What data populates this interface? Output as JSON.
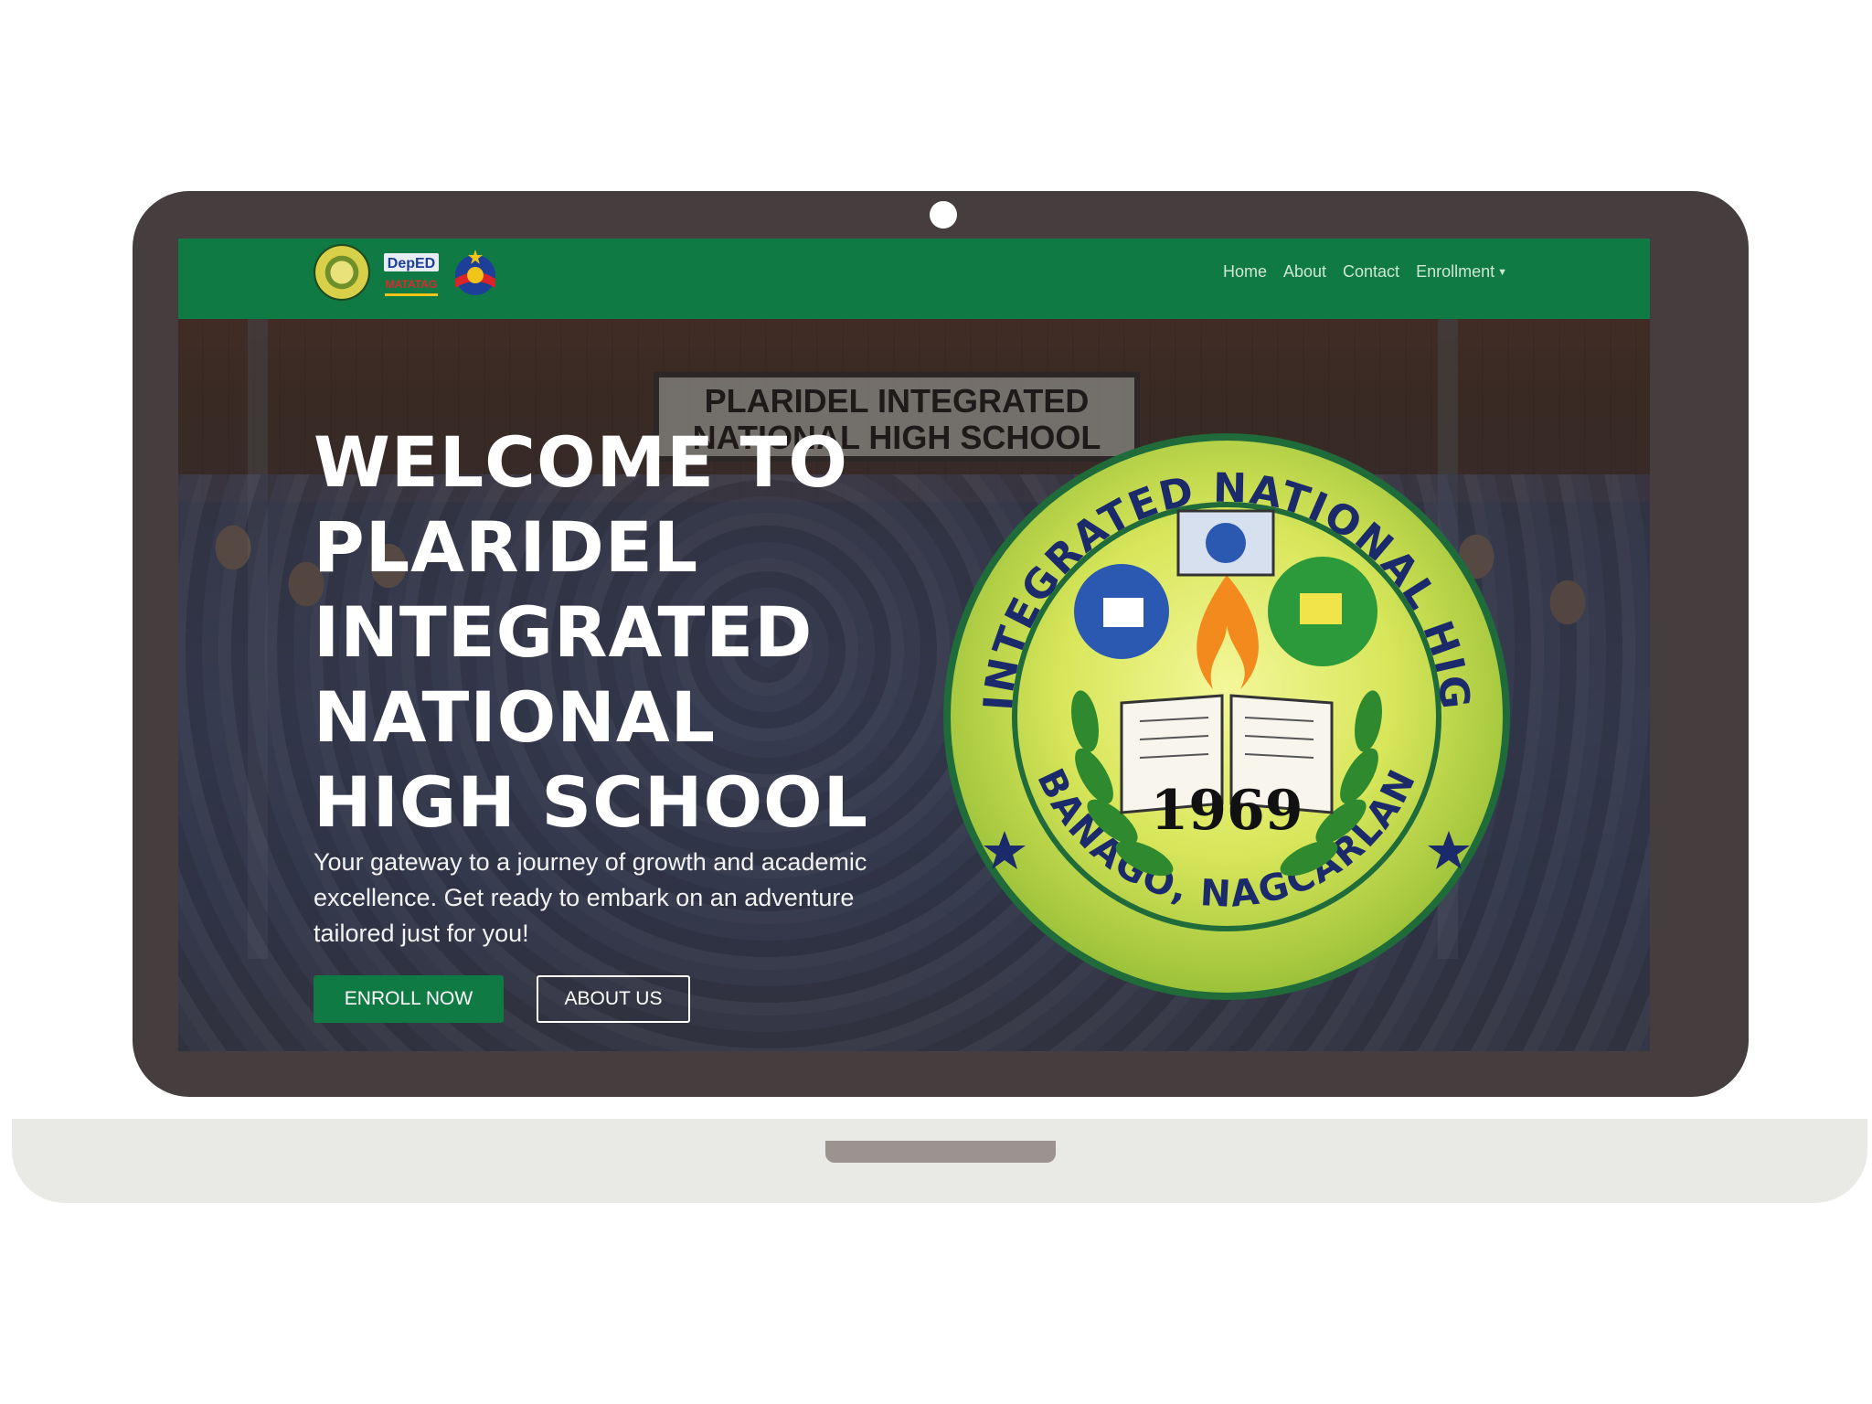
{
  "navbar": {
    "logos": [
      "school-seal-logo",
      "deped-matatag-logo",
      "bagong-pilipinas-logo"
    ],
    "deped_text": "DepED",
    "matatag_text": "MATATAG",
    "links": [
      {
        "label": "Home"
      },
      {
        "label": "About"
      },
      {
        "label": "Contact"
      },
      {
        "label": "Enrollment",
        "has_dropdown": true
      }
    ]
  },
  "hero": {
    "title_lines": [
      "WELCOME TO",
      "PLARIDEL",
      "INTEGRATED",
      "NATIONAL",
      "HIGH SCHOOL"
    ],
    "subtitle": "Your gateway to a journey of growth and academic excellence. Get ready to embark on an adventure tailored just for you!",
    "enroll_label": "ENROLL NOW",
    "about_label": "ABOUT US",
    "background_sign": "PLARIDEL INTEGRATED NATIONAL HIGH SCHOOL"
  },
  "seal": {
    "top_text": "PLARIDEL INTEGRATED NATIONAL HIGH SCHOOL",
    "bottom_text": "BANAGO, NAGCARLAN",
    "year": "1969"
  },
  "colors": {
    "brand_green": "#0f7a43",
    "laptop_frame": "#463e3e",
    "laptop_base": "#e9e9e5",
    "seal_rim": "#1f6b3a",
    "seal_fill": "#d8e65a"
  },
  "icons": [
    "chevron-up-icon",
    "chevron-down-icon",
    "caret-down-icon"
  ]
}
